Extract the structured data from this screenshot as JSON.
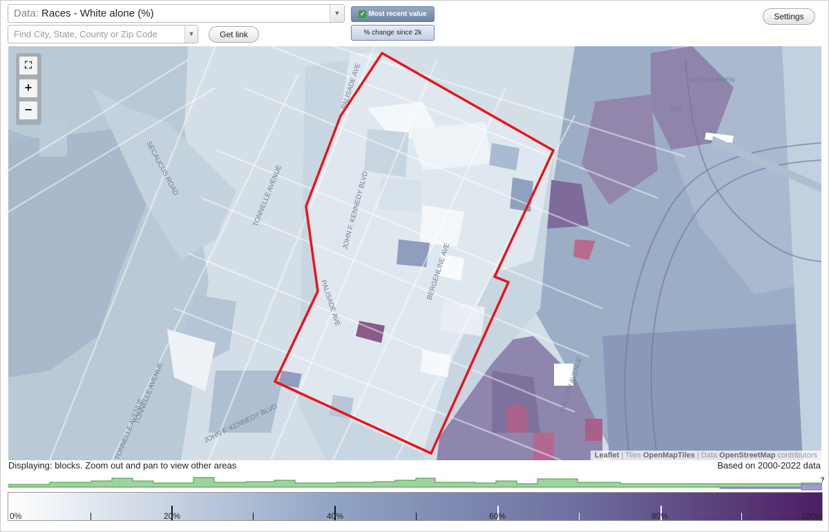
{
  "header": {
    "data_label": "Data:",
    "data_value": "Races - White alone (%)",
    "search_placeholder": "Find City, State, County or Zip Code",
    "get_link": "Get link",
    "toggle_recent": "Most recent value",
    "toggle_change": "% change since 2k",
    "settings": "Settings"
  },
  "map": {
    "labels": {
      "weehawken": "WEEHAWKEN",
      "route_495": "495",
      "tonnelle_1": "TONNELLE AVENUE",
      "tonnelle_2": "TONNELLE AVENUE",
      "tonnelle_3": "TONNELLE AVENUE",
      "kennedy_1": "JOHN F. KENNEDY BLVD",
      "kennedy_2": "JOHN F. KENNEDY BLVD",
      "palisade": "PALISADE AVE",
      "palisade_2": "PALISADE AVE",
      "bergenline": "BERGENLINE AVE",
      "sec_road": "SECAUCUS ROAD",
      "willow": "WILLOW AVENUE"
    },
    "attribution": {
      "leaflet": "Leaflet",
      "sep1": " | Tiles ",
      "tiles": "OpenMapTiles",
      "sep2": " | Data ",
      "data": "OpenStreetMap",
      "tail": " contributors"
    },
    "colors": {
      "outline": "#e8141a",
      "low": "#f3f6f9",
      "mid": "#8fa4c4",
      "high": "#4d1e62"
    }
  },
  "status": {
    "displaying": "Displaying: blocks. Zoom out and pan to view other areas",
    "based_on": "Based on 2000-2022 data"
  },
  "histogram_q": "?",
  "legend": {
    "labels": [
      "0%",
      "20%",
      "40%",
      "60%",
      "80%",
      "100%"
    ]
  }
}
